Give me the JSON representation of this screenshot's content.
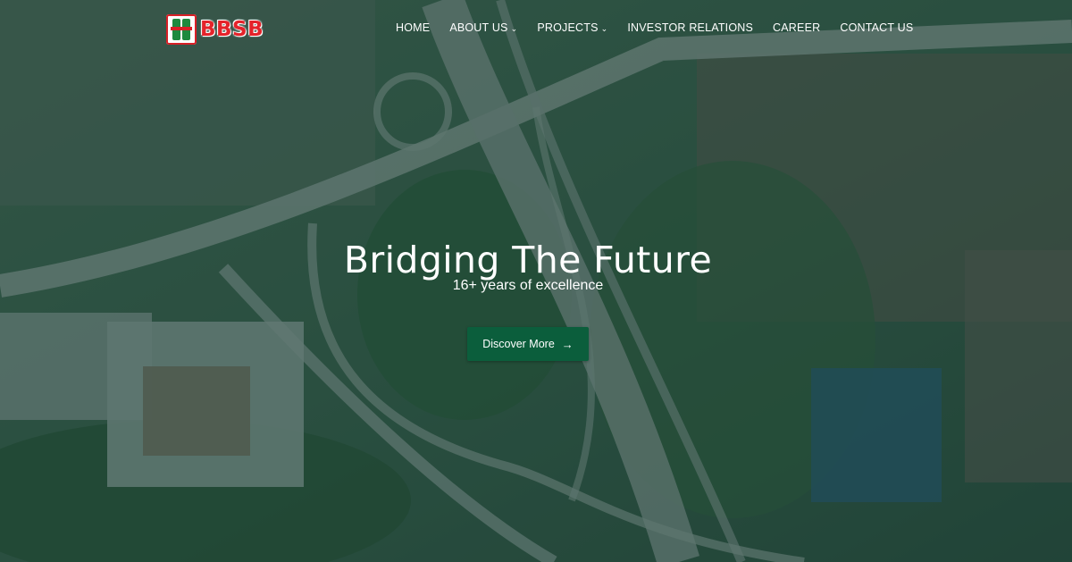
{
  "brand": {
    "name": "BBSB",
    "logo_icon": "bbsb-logo-icon",
    "brand_red": "#e4232a",
    "brand_green": "#1e8a3e"
  },
  "nav": {
    "items": [
      {
        "label": "HOME",
        "has_dropdown": false
      },
      {
        "label": "ABOUT US",
        "has_dropdown": true
      },
      {
        "label": "PROJECTS",
        "has_dropdown": true
      },
      {
        "label": "INVESTOR RELATIONS",
        "has_dropdown": false
      },
      {
        "label": "CAREER",
        "has_dropdown": false
      },
      {
        "label": "CONTACT US",
        "has_dropdown": false
      }
    ],
    "dropdown_icon": "chevron-down-icon"
  },
  "hero": {
    "title": "Bridging The Future",
    "subtitle": "16+ years of excellence",
    "cta_label": "Discover More",
    "cta_icon": "arrow-right-icon",
    "cta_color": "#0b5e3c",
    "background": "aerial-highway-image"
  }
}
